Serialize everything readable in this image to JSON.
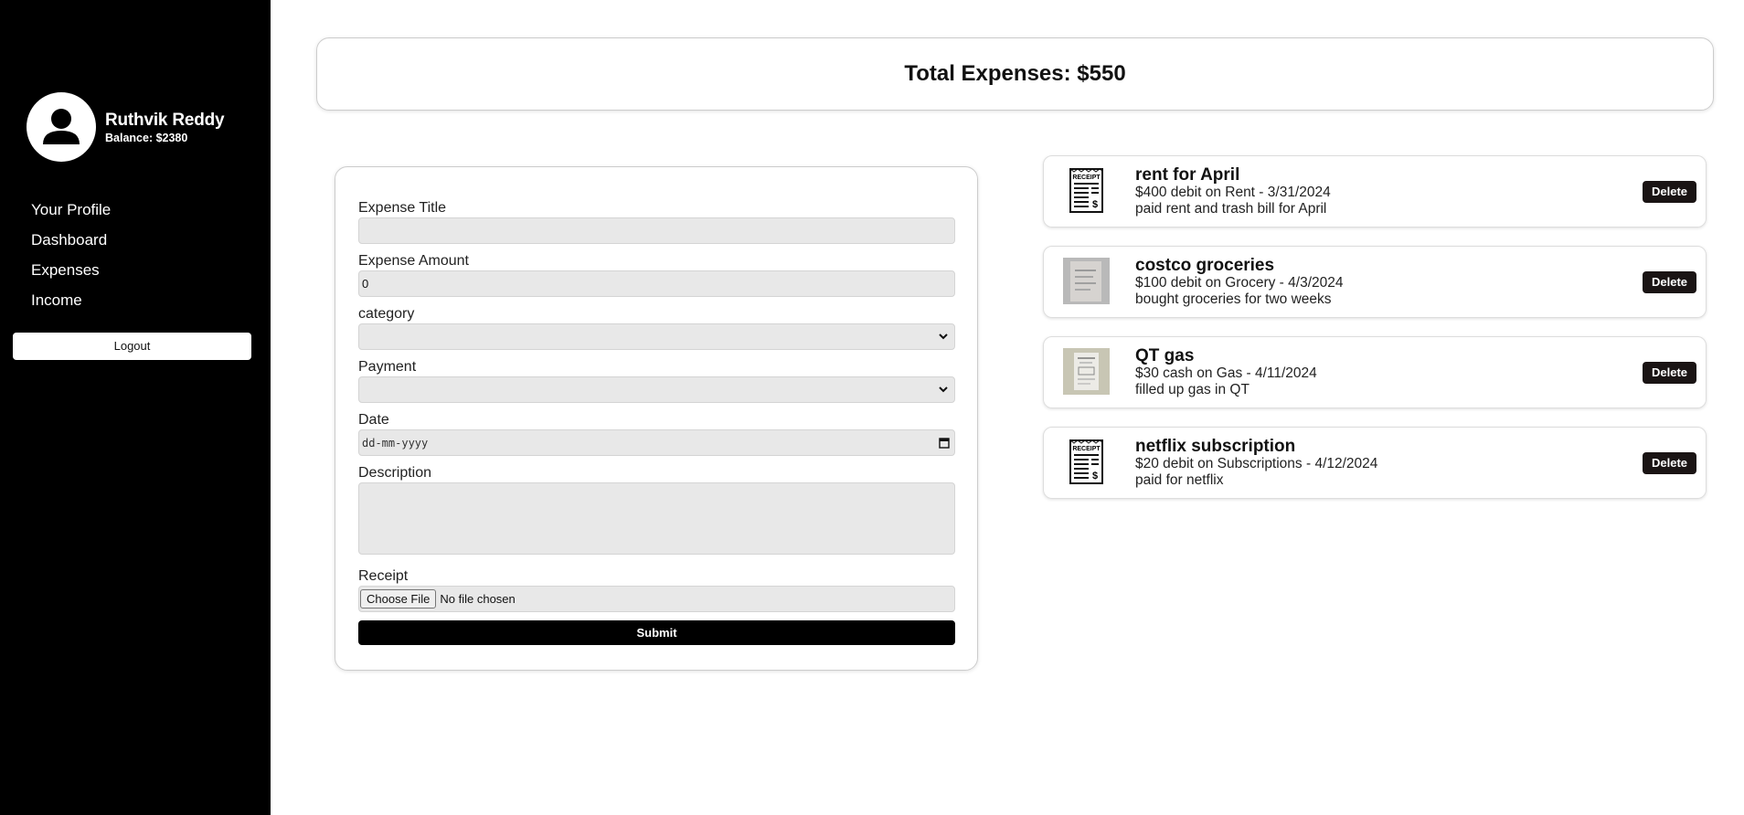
{
  "user": {
    "name": "Ruthvik Reddy",
    "balance": "Balance: $2380"
  },
  "nav": [
    {
      "label": "Your Profile"
    },
    {
      "label": "Dashboard"
    },
    {
      "label": "Expenses"
    },
    {
      "label": "Income"
    }
  ],
  "logout_label": "Logout",
  "total": "Total Expenses: $550",
  "form": {
    "title_label": "Expense Title",
    "title_value": "",
    "amount_label": "Expense Amount",
    "amount_value": "0",
    "category_label": "category",
    "category_value": "",
    "payment_label": "Payment",
    "payment_value": "",
    "date_label": "Date",
    "date_placeholder": "dd-mm-yyyy",
    "description_label": "Description",
    "description_value": "",
    "receipt_label": "Receipt",
    "choose_file": "Choose File",
    "file_status": "No file chosen",
    "submit_label": "Submit"
  },
  "expenses": [
    {
      "title": "rent for April",
      "detail": "$400 debit on Rent - 3/31/2024",
      "description": "paid rent and trash bill for April",
      "image": "receipt-icon",
      "delete_label": "Delete"
    },
    {
      "title": "costco groceries",
      "detail": "$100 debit on Grocery - 4/3/2024",
      "description": "bought groceries for two weeks",
      "image": "receipt-photo",
      "delete_label": "Delete"
    },
    {
      "title": "QT gas",
      "detail": "$30 cash on Gas - 4/11/2024",
      "description": "filled up gas in QT",
      "image": "receipt-photo",
      "delete_label": "Delete"
    },
    {
      "title": "netflix subscription",
      "detail": "$20 debit on Subscriptions - 4/12/2024",
      "description": "paid for netflix",
      "image": "receipt-icon",
      "delete_label": "Delete"
    }
  ]
}
